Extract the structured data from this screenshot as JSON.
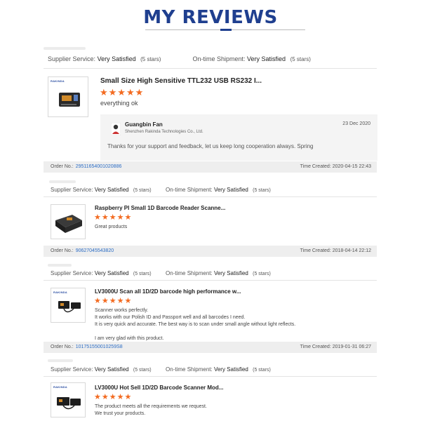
{
  "page_title": "MY REVIEWS",
  "labels": {
    "supplier_service": "Supplier Service:",
    "ontime_shipment": "On-time Shipment:",
    "order_no": "Order No.:",
    "time_created": "Time Created:"
  },
  "reviews": [
    {
      "supplier_rating": "Very Satisfied",
      "supplier_stars": "(5 stars)",
      "shipment_rating": "Very Satisfied",
      "shipment_stars": "(5 stars)",
      "product_title": "Small Size High Sensitive TTL232 USB RS232 I...",
      "stars": "★★★★★",
      "text": [
        "everything ok"
      ],
      "reply": {
        "name": "Guangbin Fan",
        "company": "Shenzhen Rakinda Technologies Co., Ltd.",
        "date": "23 Dec 2020",
        "text": "Thanks for your support and feedback, let us keep long cooperation always. Spring"
      }
    },
    {
      "order_no": "29511654001020886",
      "time_created": "2020-04-15 22:43",
      "supplier_rating": "Very Satisfied",
      "supplier_stars": "(5 stars)",
      "shipment_rating": "Very Satisfied",
      "shipment_stars": "(5 stars)",
      "product_title": "Raspberry PI Small 1D Barcode Reader Scanne...",
      "stars": "★★★★★",
      "text": [
        "Great products"
      ]
    },
    {
      "order_no": "90627045543820",
      "time_created": "2018-04-14 22:12",
      "supplier_rating": "Very Satisfied",
      "supplier_stars": "(5 stars)",
      "shipment_rating": "Very Satisfied",
      "shipment_stars": "(5 stars)",
      "product_title": "LV3000U Scan all 1D/2D barcode high performance w...",
      "stars": "★★★★★",
      "text": [
        "Scanner works perfectly.",
        "It works with our Polish ID and Passport well and all barcodes I need.",
        "It is very quick and accurate. The best way is to scan under small angle without light reflects.",
        "",
        "I am very glad with this product."
      ]
    },
    {
      "order_no": "101751550010259S8",
      "time_created": "2019-01-31 06:27",
      "supplier_rating": "Very Satisfied",
      "supplier_stars": "(5 stars)",
      "shipment_rating": "Very Satisfied",
      "shipment_stars": "(5 stars)",
      "product_title": "LV3000U Hot Sell 1D/2D Barcode Scanner Mod...",
      "stars": "★★★★★",
      "text": [
        "The product meets all the requirements we request.",
        "We trust your products."
      ]
    }
  ],
  "colors": {
    "title": "#1f3f8f",
    "star": "#f36b21",
    "link": "#2b6cc4"
  }
}
